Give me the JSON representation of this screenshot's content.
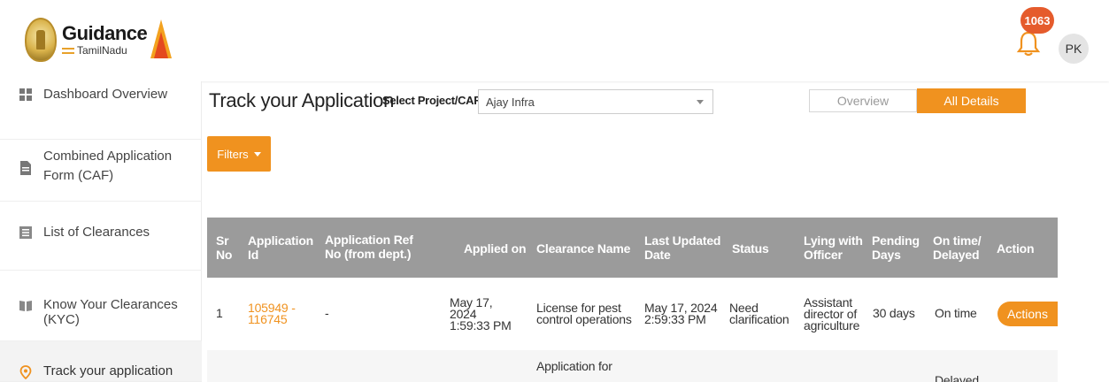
{
  "header": {
    "logo": {
      "brand": "Guidance",
      "sub": "TamilNadu"
    },
    "notification_count": "1063",
    "avatar_initials": "PK"
  },
  "sidebar": {
    "items": [
      {
        "label": "Dashboard Overview",
        "icon": "grid-icon"
      },
      {
        "label": "Combined Application Form (CAF)",
        "icon": "document-icon"
      },
      {
        "label": "List of Clearances",
        "icon": "list-icon"
      },
      {
        "label": "Know Your Clearances (KYC)",
        "icon": "book-icon"
      },
      {
        "label": "Track your application",
        "icon": "location-pin-icon",
        "active": true
      }
    ]
  },
  "main": {
    "title": "Track your Application",
    "select_label": "Select Project/CAF",
    "select_value": "Ajay Infra",
    "tabs": [
      {
        "label": "Overview",
        "active": false
      },
      {
        "label": "All Details",
        "active": true
      }
    ],
    "filters_label": "Filters"
  },
  "table": {
    "headers": {
      "sr_no": [
        "Sr",
        "No"
      ],
      "app_id": [
        "Application",
        "Id"
      ],
      "ref_no": [
        "Application Ref",
        "No (from dept.)"
      ],
      "applied_on": "Applied on",
      "clearance_name": "Clearance Name",
      "last_updated": [
        "Last Updated",
        "Date"
      ],
      "status": "Status",
      "lying_with": [
        "Lying with",
        "Officer"
      ],
      "pending_days": [
        "Pending",
        "Days"
      ],
      "on_time": [
        "On time/",
        "Delayed"
      ],
      "action": "Action"
    },
    "rows": [
      {
        "sr_no": "1",
        "app_id": [
          "105949 -",
          "116745"
        ],
        "ref_no": "-",
        "applied_on": [
          "May 17,",
          "2024",
          "1:59:33 PM"
        ],
        "clearance_name": [
          "License for pest",
          "control operations"
        ],
        "last_updated": [
          "May 17, 2024",
          "2:59:33 PM"
        ],
        "status": [
          "Need",
          "clarification"
        ],
        "lying_with": [
          "Assistant",
          "director of",
          "agriculture"
        ],
        "pending_days": "30 days",
        "on_time": "On time",
        "action_label": "Actions"
      },
      {
        "clearance_name": [
          "Application for"
        ],
        "on_time": "Delayed"
      }
    ]
  },
  "colors": {
    "accent": "#f0921f",
    "table_header": "#9b9b9b",
    "badge": "#e55b2c"
  }
}
